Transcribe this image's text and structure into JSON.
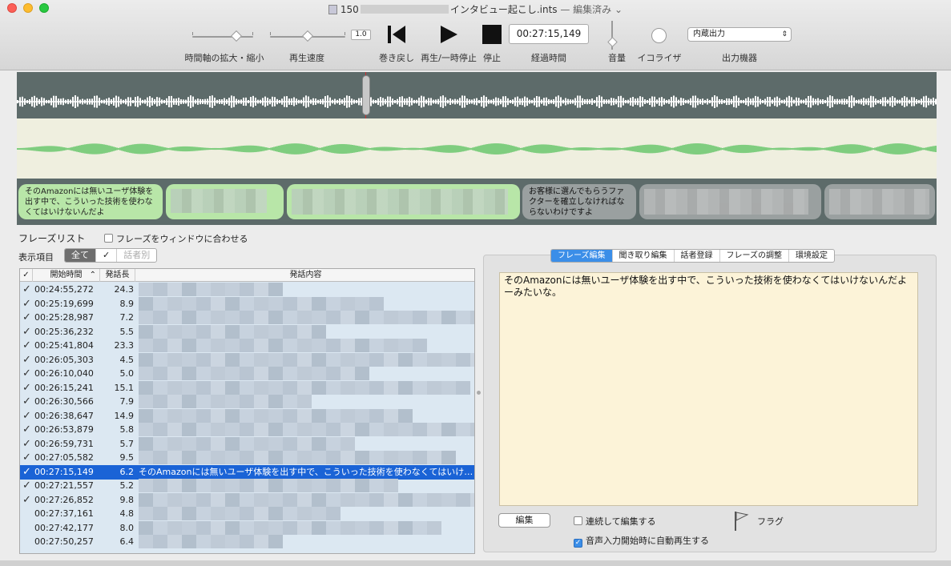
{
  "window": {
    "title_prefix": "150",
    "title_name": "インタビュー起こし.ints",
    "title_status": "— 編集済み",
    "title_chevron": "⌄"
  },
  "toolbar": {
    "zoom_label": "時間軸の拡大・縮小",
    "speed_label": "再生速度",
    "rate_value": "1.0",
    "rewind_label": "巻き戻し",
    "play_label": "再生/一時停止",
    "stop_label": "停止",
    "elapsed_value": "00:27:15,149",
    "elapsed_label": "経過時間",
    "volume_label": "音量",
    "eq_label": "イコライザ",
    "output_value": "内蔵出力",
    "output_label": "出力機器"
  },
  "phrases": [
    {
      "text": "そのAmazonには無いユーザ体験を出す中で、こういった技術を使わなくてはいけないんだよ",
      "color": "green"
    },
    {
      "text": "",
      "color": "green"
    },
    {
      "text": "",
      "color": "green"
    },
    {
      "text": "お客様に選んでもらうファクターを確立しなければならないわけですよ",
      "color": "grey"
    },
    {
      "text": "",
      "color": "grey"
    },
    {
      "text": "",
      "color": "grey"
    }
  ],
  "list": {
    "title": "フレーズリスト",
    "fit_window_label": "フレーズをウィンドウに合わせる",
    "display_label": "表示項目",
    "filters": [
      "全て",
      "✓",
      "話者別"
    ],
    "columns": {
      "check": "✓",
      "start": "開始時間",
      "sort": "⌃",
      "duration": "発話長",
      "content": "発話内容"
    },
    "rows": [
      {
        "checked": "✓",
        "time": "00:24:55,272",
        "dur": "24.3",
        "text": ""
      },
      {
        "checked": "✓",
        "time": "00:25:19,699",
        "dur": "8.9",
        "text": ""
      },
      {
        "checked": "✓",
        "time": "00:25:28,987",
        "dur": "7.2",
        "text": ""
      },
      {
        "checked": "✓",
        "time": "00:25:36,232",
        "dur": "5.5",
        "text": ""
      },
      {
        "checked": "✓",
        "time": "00:25:41,804",
        "dur": "23.3",
        "text": ""
      },
      {
        "checked": "✓",
        "time": "00:26:05,303",
        "dur": "4.5",
        "text": ""
      },
      {
        "checked": "✓",
        "time": "00:26:10,040",
        "dur": "5.0",
        "text": ""
      },
      {
        "checked": "✓",
        "time": "00:26:15,241",
        "dur": "15.1",
        "text": ""
      },
      {
        "checked": "✓",
        "time": "00:26:30,566",
        "dur": "7.9",
        "text": ""
      },
      {
        "checked": "✓",
        "time": "00:26:38,647",
        "dur": "14.9",
        "text": ""
      },
      {
        "checked": "✓",
        "time": "00:26:53,879",
        "dur": "5.8",
        "text": ""
      },
      {
        "checked": "✓",
        "time": "00:26:59,731",
        "dur": "5.7",
        "text": ""
      },
      {
        "checked": "✓",
        "time": "00:27:05,582",
        "dur": "9.5",
        "text": ""
      },
      {
        "checked": "✓",
        "time": "00:27:15,149",
        "dur": "6.2",
        "text": "そのAmazonには無いユーザ体験を出す中で、こういった技術を使わなくてはいけ…",
        "selected": true
      },
      {
        "checked": "✓",
        "time": "00:27:21,557",
        "dur": "5.2",
        "text": ""
      },
      {
        "checked": "✓",
        "time": "00:27:26,852",
        "dur": "9.8",
        "text": ""
      },
      {
        "checked": "",
        "time": "00:27:37,161",
        "dur": "4.8",
        "text": ""
      },
      {
        "checked": "",
        "time": "00:27:42,177",
        "dur": "8.0",
        "text": ""
      },
      {
        "checked": "",
        "time": "00:27:50,257",
        "dur": "6.4",
        "text": ""
      }
    ]
  },
  "editor": {
    "tabs": [
      "フレーズ編集",
      "聞き取り編集",
      "話者登録",
      "フレーズの調整",
      "環境設定"
    ],
    "text": "そのAmazonには無いユーザ体験を出す中で、こういった技術を使わなくてはいけないんだよーみたいな。",
    "edit_button": "編集",
    "continuous_label": "連続して編集する",
    "flag_label": "フラグ",
    "autoplay_label": "音声入力開始時に自動再生する",
    "autoplay_check": "✓"
  },
  "colors": {
    "accent": "#3b8ee8",
    "selected_row": "#1a63d6",
    "phrase_green": "#b8e6a8",
    "wave_bg": "#5d6b6a"
  }
}
